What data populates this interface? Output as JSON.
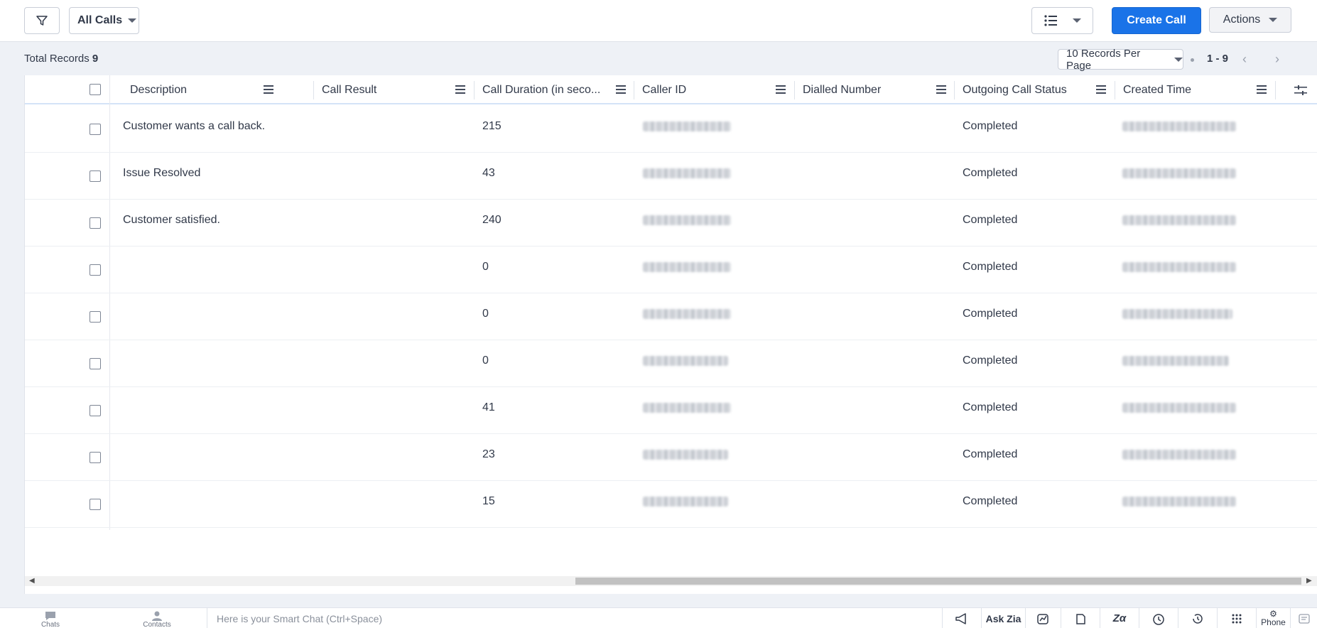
{
  "toolbar": {
    "filter_icon": "funnel-icon",
    "view_label": "All Calls",
    "layout_icon": "list-view-icon",
    "create_label": "Create Call",
    "actions_label": "Actions",
    "brand_color": "#1a73e8"
  },
  "subbar": {
    "total_label": "Total Records",
    "total_count": "9",
    "per_page": "10 Records Per Page",
    "range": "1 - 9"
  },
  "columns": [
    "Description",
    "Call Result",
    "Call Duration (in seco...",
    "Caller ID",
    "Dialled Number",
    "Outgoing Call Status",
    "Created Time"
  ],
  "rows": [
    {
      "description": "Customer wants a call back.",
      "call_result": "",
      "duration": "215",
      "status": "Completed"
    },
    {
      "description": "Issue Resolved",
      "call_result": "",
      "duration": "43",
      "status": "Completed"
    },
    {
      "description": "Customer satisfied.",
      "call_result": "",
      "duration": "240",
      "status": "Completed"
    },
    {
      "description": "",
      "call_result": "",
      "duration": "0",
      "status": "Completed"
    },
    {
      "description": "",
      "call_result": "",
      "duration": "0",
      "status": "Completed"
    },
    {
      "description": "",
      "call_result": "",
      "duration": "0",
      "status": "Completed"
    },
    {
      "description": "",
      "call_result": "",
      "duration": "41",
      "status": "Completed"
    },
    {
      "description": "",
      "call_result": "",
      "duration": "23",
      "status": "Completed"
    },
    {
      "description": "",
      "call_result": "",
      "duration": "15",
      "status": "Completed"
    }
  ],
  "bottombar": {
    "chats_label": "Chats",
    "contacts_label": "Contacts",
    "smart_chat_placeholder": "Here is your Smart Chat (Ctrl+Space)",
    "ask_zia_label": "Ask Zia",
    "phone_label": "Phone"
  }
}
